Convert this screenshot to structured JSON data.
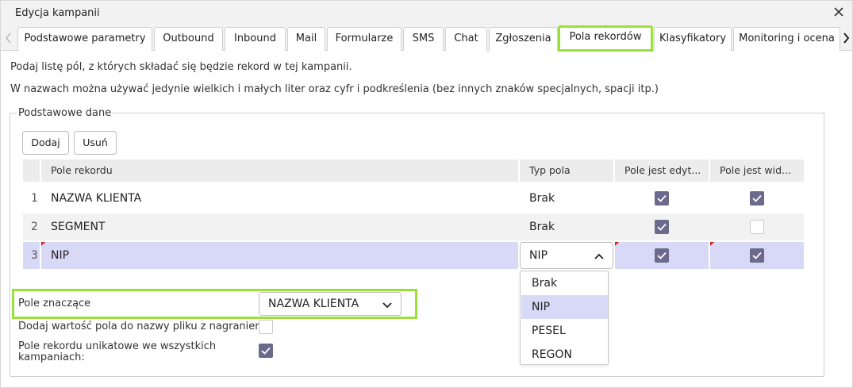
{
  "window": {
    "title": "Edycja kampanii"
  },
  "tabs": [
    {
      "label": "Podstawowe parametry"
    },
    {
      "label": "Outbound"
    },
    {
      "label": "Inbound"
    },
    {
      "label": "Mail"
    },
    {
      "label": "Formularze"
    },
    {
      "label": "SMS"
    },
    {
      "label": "Chat"
    },
    {
      "label": "Zgłoszenia"
    },
    {
      "label": "Pola rekordów"
    },
    {
      "label": "Klasyfikatory"
    },
    {
      "label": "Monitoring i ocena"
    }
  ],
  "intro": {
    "line1": "Podaj listę pól, z których składać się będzie rekord w tej kampanii.",
    "line2": "W nazwach można używać jedynie wielkich i małych liter oraz cyfr i podkreślenia (bez innych znaków specjalnych, spacji itp.)"
  },
  "section": {
    "legend": "Podstawowe dane",
    "add_label": "Dodaj",
    "remove_label": "Usuń"
  },
  "table": {
    "headers": [
      "",
      "Pole rekordu",
      "Typ pola",
      "Pole jest edyt...",
      "Pole jest wid..."
    ],
    "rows": [
      {
        "num": "1",
        "name": "NAZWA KLIENTA",
        "type": "Brak",
        "editable": true,
        "visible": true
      },
      {
        "num": "2",
        "name": "SEGMENT",
        "type": "Brak",
        "editable": true,
        "visible": false
      },
      {
        "num": "3",
        "name": "NIP",
        "type": "NIP",
        "editable": true,
        "visible": true
      }
    ]
  },
  "type_dropdown": {
    "options": [
      "Brak",
      "NIP",
      "PESEL",
      "REGON"
    ],
    "selected": "NIP"
  },
  "options": {
    "significant_label": "Pole znaczące",
    "significant_value": "NAZWA KLIENTA",
    "add_value_label": "Dodaj wartość pola do nazwy pliku z nagraniem:",
    "add_value_checked": false,
    "unique_label_1": "Pole rekordu unikatowe we wszystkich",
    "unique_label_2": "kampaniach:",
    "unique_checked": true
  },
  "colors": {
    "accent_highlight": "#9be03a",
    "selected_row": "#d7d9f7",
    "checkbox_on": "#6b6a8c"
  }
}
